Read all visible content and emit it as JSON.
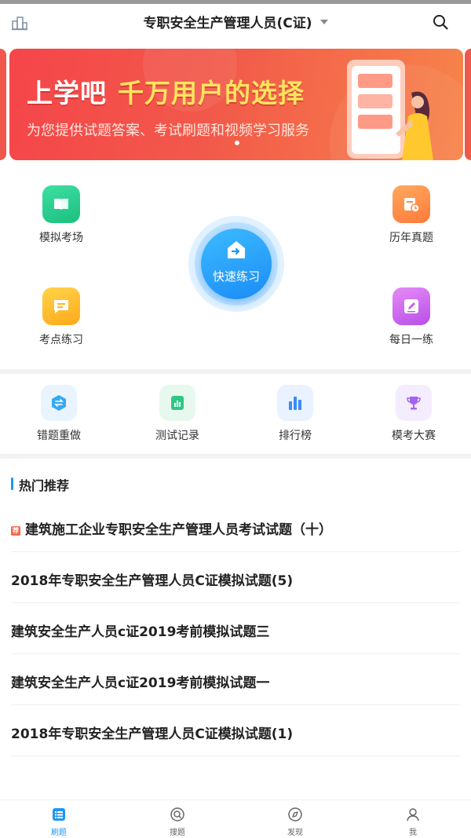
{
  "header": {
    "title": "专职安全生产管理人员(C证)",
    "left_icon": "city-icon",
    "right_icon": "search-icon"
  },
  "banner": {
    "headline_white": "上学吧",
    "headline_yellow": "千万用户的选择",
    "subtitle": "为您提供试题答案、考试刷题和视频学习服务",
    "colors": {
      "from": "#f5454a",
      "to": "#f7844a",
      "accent": "#ffe45e"
    }
  },
  "features": {
    "mock_exam": "模拟考场",
    "past_papers": "历年真题",
    "quick_practice": "快速练习",
    "point_practice": "考点练习",
    "daily_practice": "每日一练"
  },
  "tools": {
    "wrong_redo": "错题重做",
    "test_records": "测试记录",
    "ranking": "排行榜",
    "mock_contest": "模考大赛"
  },
  "hot": {
    "title": "热门推荐",
    "tag": "荐",
    "items": [
      "建筑施工企业专职安全生产管理人员考试试题（十）",
      "2018年专职安全生产管理人员C证模拟试题(5)",
      "建筑安全生产人员c证2019考前模拟试题三",
      "建筑安全生产人员c证2019考前模拟试题一",
      "2018年专职安全生产管理人员C证模拟试题(1)"
    ]
  },
  "tabbar": {
    "items": [
      "刷题",
      "搜题",
      "发现",
      "我"
    ],
    "active": "刷题",
    "active_color": "#2196f3"
  }
}
